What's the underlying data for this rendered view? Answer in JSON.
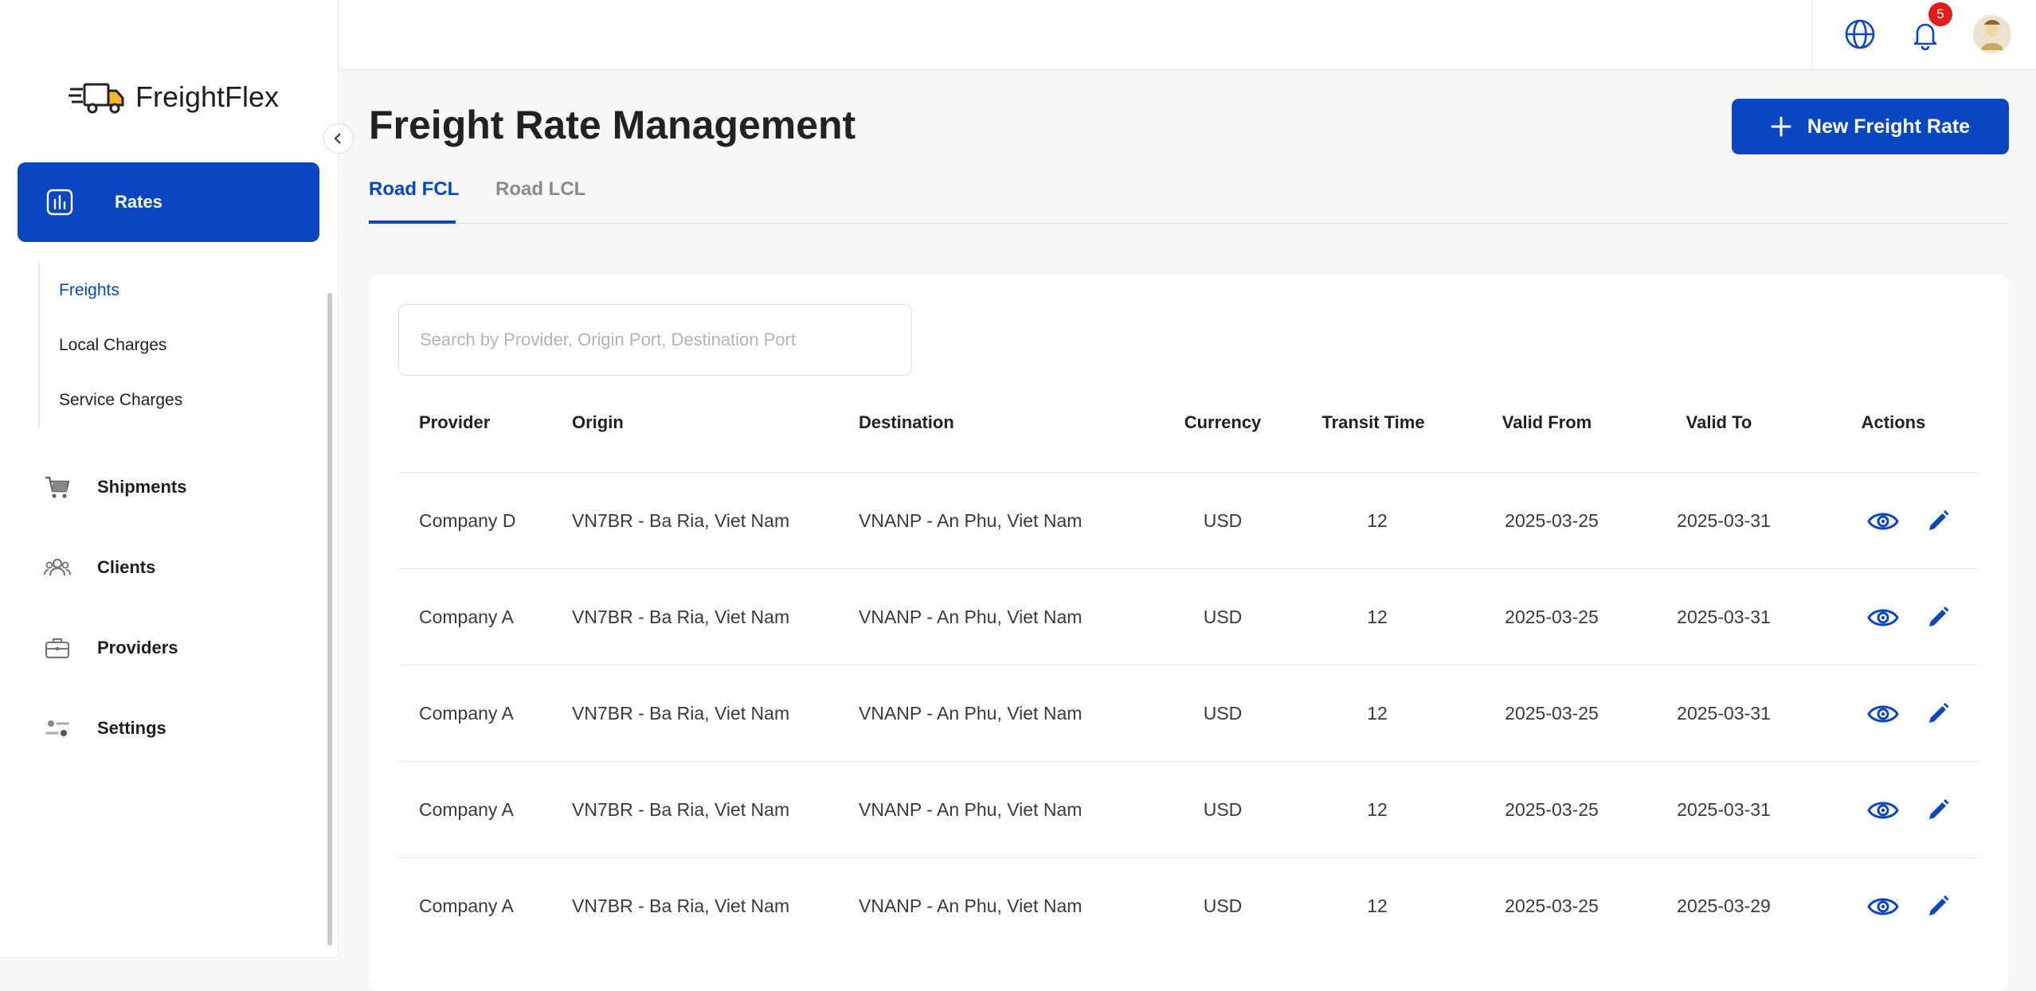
{
  "brand": {
    "name": "FreightFlex"
  },
  "sidebar": {
    "active": {
      "label": "Rates",
      "icon": "chart-icon"
    },
    "sub_items": [
      {
        "label": "Freights",
        "active": true
      },
      {
        "label": "Local Charges",
        "active": false
      },
      {
        "label": "Service Charges",
        "active": false
      }
    ],
    "items": [
      {
        "label": "Shipments",
        "icon": "cart-icon"
      },
      {
        "label": "Clients",
        "icon": "users-icon"
      },
      {
        "label": "Providers",
        "icon": "briefcase-icon"
      },
      {
        "label": "Settings",
        "icon": "sliders-icon"
      }
    ]
  },
  "topbar": {
    "icons": [
      "globe-icon",
      "bell-icon"
    ],
    "notification_count": "5",
    "avatar": "user-avatar"
  },
  "page": {
    "title": "Freight Rate Management",
    "new_button": "New Freight Rate",
    "tabs": [
      {
        "label": "Road FCL",
        "active": true
      },
      {
        "label": "Road LCL",
        "active": false
      }
    ]
  },
  "table": {
    "search_placeholder": "Search by Provider, Origin Port, Destination Port",
    "columns": [
      "Provider",
      "Origin",
      "Destination",
      "Currency",
      "Transit Time",
      "Valid From",
      "Valid To",
      "Actions"
    ],
    "rows": [
      {
        "provider": "Company D",
        "origin": "VN7BR - Ba Ria, Viet Nam",
        "destination": "VNANP - An Phu, Viet Nam",
        "currency": "USD",
        "transit": "12",
        "valid_from": "2025-03-25",
        "valid_to": "2025-03-31"
      },
      {
        "provider": "Company A",
        "origin": "VN7BR - Ba Ria, Viet Nam",
        "destination": "VNANP - An Phu, Viet Nam",
        "currency": "USD",
        "transit": "12",
        "valid_from": "2025-03-25",
        "valid_to": "2025-03-31"
      },
      {
        "provider": "Company A",
        "origin": "VN7BR - Ba Ria, Viet Nam",
        "destination": "VNANP - An Phu, Viet Nam",
        "currency": "USD",
        "transit": "12",
        "valid_from": "2025-03-25",
        "valid_to": "2025-03-31"
      },
      {
        "provider": "Company A",
        "origin": "VN7BR - Ba Ria, Viet Nam",
        "destination": "VNANP - An Phu, Viet Nam",
        "currency": "USD",
        "transit": "12",
        "valid_from": "2025-03-25",
        "valid_to": "2025-03-31"
      },
      {
        "provider": "Company A",
        "origin": "VN7BR - Ba Ria, Viet Nam",
        "destination": "VNANP - An Phu, Viet Nam",
        "currency": "USD",
        "transit": "12",
        "valid_from": "2025-03-25",
        "valid_to": "2025-03-29"
      }
    ],
    "row_actions": [
      "view-icon",
      "edit-icon"
    ]
  },
  "colors": {
    "primary": "#0b46c1",
    "badge": "#e21b1b",
    "background": "#f7f7f7"
  }
}
